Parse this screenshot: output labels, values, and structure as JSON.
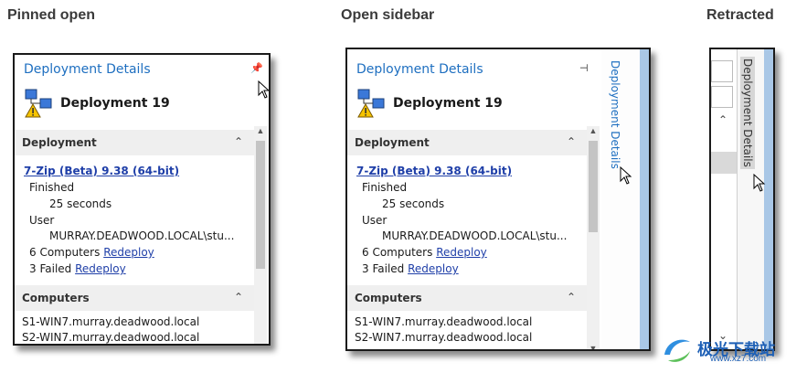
{
  "captions": {
    "pinned": "Pinned open",
    "open": "Open sidebar",
    "retracted": "Retracted"
  },
  "panel": {
    "title": "Deployment Details",
    "deployment_name": "Deployment 19",
    "section_deployment": "Deployment",
    "package_link": "7-Zip (Beta) 9.38 (64-bit)",
    "status_label": "Finished",
    "duration": "25 seconds",
    "user_label": "User",
    "user_value": "MURRAY.DEADWOOD.LOCAL\\stu...",
    "computers_count": "6 Computers",
    "failed_count": "3 Failed",
    "redeploy": "Redeploy",
    "section_computers": "Computers",
    "computers": [
      "S1-WIN7.murray.deadwood.local",
      "S2-WIN7.murray.deadwood.local"
    ]
  },
  "side_tab_label": "Deployment Details",
  "icons": {
    "pin_pinned": "pin-icon",
    "pin_unpinned": "unpin-icon",
    "chevron": "chevron-up-icon",
    "deployment": "deployment-warning-icon",
    "cursor": "mouse-cursor-icon"
  },
  "watermark": {
    "text": "极光下载站",
    "sub": "www.xz7.com"
  },
  "colors": {
    "title_blue": "#1e6fc0",
    "link_blue": "#1f3fa8",
    "section_bg": "#efefef",
    "edge_blue": "#a9c7e6"
  }
}
